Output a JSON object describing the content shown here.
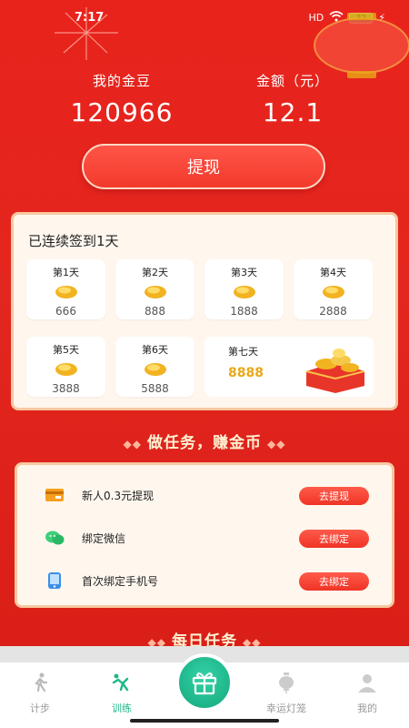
{
  "status_bar": {
    "time": "7:17",
    "signal": "HD",
    "battery": "32"
  },
  "stats": {
    "beans_label": "我的金豆",
    "beans_value": "120966",
    "amount_label": "金额（元）",
    "amount_value": "12.1"
  },
  "withdraw_button": "提现",
  "signin": {
    "title": "已连续签到1天",
    "days": [
      {
        "label": "第1天",
        "amount": "666"
      },
      {
        "label": "第2天",
        "amount": "888"
      },
      {
        "label": "第3天",
        "amount": "1888"
      },
      {
        "label": "第4天",
        "amount": "2888"
      },
      {
        "label": "第5天",
        "amount": "3888"
      },
      {
        "label": "第6天",
        "amount": "5888"
      }
    ],
    "day7": {
      "label": "第七天",
      "amount": "8888"
    }
  },
  "tasks_section_title": "做任务，赚金币",
  "tasks": [
    {
      "icon": "card-icon",
      "label": "新人0.3元提现",
      "button": "去提现"
    },
    {
      "icon": "wechat-icon",
      "label": "绑定微信",
      "button": "去绑定"
    },
    {
      "icon": "phone-icon",
      "label": "首次绑定手机号",
      "button": "去绑定"
    }
  ],
  "daily_section_title": "每日任务",
  "tabbar": {
    "items": [
      {
        "label": "计步",
        "icon": "walking-icon"
      },
      {
        "label": "训练",
        "icon": "training-icon",
        "active": true
      },
      {
        "label": "幸运灯笼",
        "icon": "lantern-icon"
      },
      {
        "label": "我的",
        "icon": "profile-icon"
      }
    ],
    "center_icon": "gift-icon"
  },
  "colors": {
    "primary_red": "#e8231c",
    "accent_green": "#1fb88a",
    "gold": "#e8a817"
  }
}
